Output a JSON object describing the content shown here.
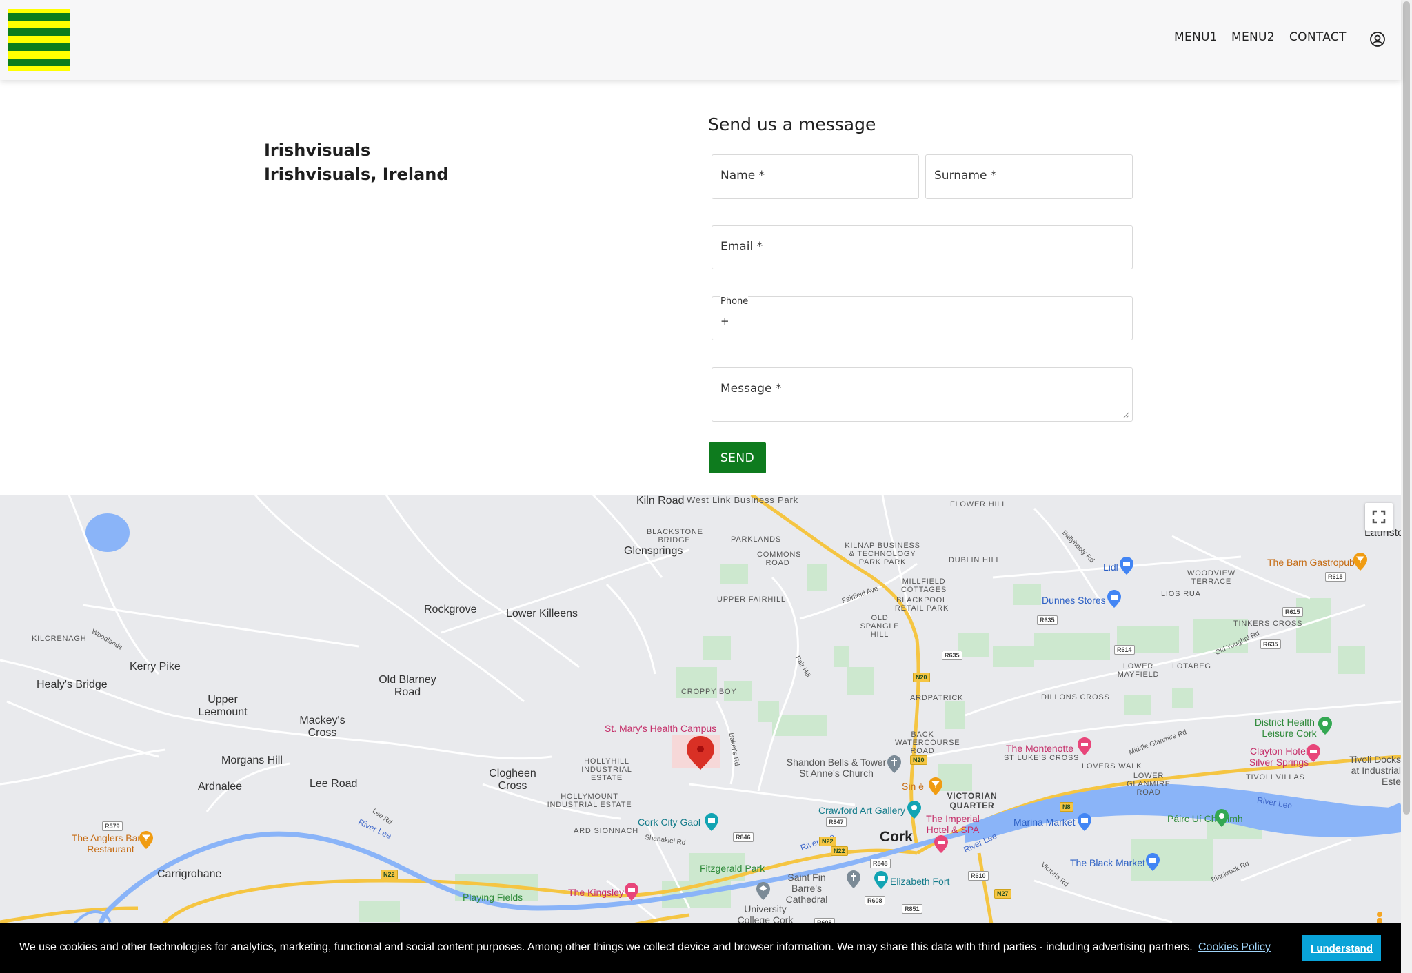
{
  "header": {
    "nav": [
      "MENU1",
      "MENU2",
      "CONTACT"
    ],
    "logo_colors": {
      "green": "#0b7d1c",
      "yellow": "#ffff00"
    }
  },
  "company": {
    "line1": "Irishvisuals",
    "line2": "Irishvisuals, Ireland"
  },
  "form": {
    "title": "Send us a message",
    "name_placeholder": "Name *",
    "surname_placeholder": "Surname *",
    "email_placeholder": "Email *",
    "phone_label": "Phone",
    "phone_value": "+",
    "message_placeholder": "Message *",
    "send_label": "SEND",
    "send_color": "#0e7b1e"
  },
  "map": {
    "city": "Cork",
    "towns": [
      "Kiln Road",
      "Glensprings",
      "Rockgrove",
      "Lower Killeens",
      "Kerry Pike",
      "Healy's Bridge",
      "Upper Leemount",
      "Old Blarney Road",
      "Mackey's Cross",
      "Morgans Hill",
      "Ardnalee",
      "Lee Road",
      "Clogheen Cross",
      "Carrigrohane",
      "Lauriston"
    ],
    "areas": [
      "West Link Business Park",
      "BLACKSTONE BRIDGE",
      "PARKLANDS",
      "COMMONS ROAD",
      "KILNAP BUSINESS & TECHNOLOGY PARK PARK",
      "FLOWER HILL",
      "DUBLIN HILL",
      "MILLFIELD COTTAGES",
      "BLACKPOOL RETAIL PARK",
      "OLD SPANGLE HILL",
      "UPPER FAIRHILL",
      "KILCRENAGH",
      "CROPPY BOY",
      "ARDPATRICK",
      "BACK WATERCOURSE ROAD",
      "HOLLYHILL INDUSTRIAL ESTATE",
      "HOLLYMOUNT INDUSTRIAL ESTATE",
      "ARD SIONNACH",
      "VICTORIAN QUARTER",
      "ST LUKE'S CROSS",
      "LOVERS WALK",
      "LOWER GLANMIRE ROAD",
      "TIVOLI VILLAS",
      "DILLONS CROSS",
      "LOWER MAYFIELD",
      "LOTABEG",
      "TINKERS CROSS",
      "WOODVIEW TERRACE",
      "LIOS RUA"
    ],
    "pois": {
      "health": "St. Mary's Health Campus",
      "shandon": "Shandon Bells & Tower St Anne's Church",
      "crawford": "Crawford Art Gallery",
      "imperial": "The Imperial Hotel & SPA",
      "marina": "Marina Market",
      "gaol": "Cork City Gaol",
      "fitzgerald": "Fitzgerald Park",
      "kingsley": "The Kingsley",
      "playing": "Playing Fields",
      "finbarre": "Saint Fin Barre's Cathedral",
      "elizabeth": "Elizabeth Fort",
      "ucc": "University College Cork",
      "montenotte": "The Montenotte",
      "clayton": "Clayton Hotel Silver Springs",
      "district": "District Health & Leisure Cork",
      "pairc": "Páirc Uí Chaoimh",
      "blackmarket": "The Black Market",
      "lidl": "Lidl",
      "dunnes": "Dunnes Stores",
      "barn": "The Barn Gastropub",
      "anglers": "The Anglers Bar & Restaurant",
      "sine": "Sin é",
      "tivoli": "Tivoli Docks at Industrial Este"
    },
    "rivers": [
      "River Lee",
      "River Lee",
      "River Lee",
      "River Lee"
    ],
    "roads": [
      "Woodlands",
      "Fairfield Ave",
      "Fair Hill",
      "Baker's Rd",
      "Shanakiel Rd",
      "Lee Rd",
      "Ballyhooly Rd",
      "Old Youghal Rd",
      "Middle Glanmire Rd",
      "Victoria Rd",
      "Blackrock Rd"
    ],
    "shields": [
      "N20",
      "N20",
      "N22",
      "N22",
      "N8",
      "N27",
      "R635",
      "R635",
      "R614",
      "R615",
      "R615",
      "R635",
      "R847",
      "R846",
      "R848",
      "R610",
      "R608",
      "R851",
      "R579",
      "N22",
      "R608"
    ],
    "marker_color": "#d93025"
  },
  "cookie": {
    "text": "We use cookies and other technologies for analytics, marketing, functional and social content purposes. Among other things we collect device and browser information. We may share this data with third parties - including advertising partners.",
    "link": "Cookies Policy",
    "button": "I understand"
  }
}
